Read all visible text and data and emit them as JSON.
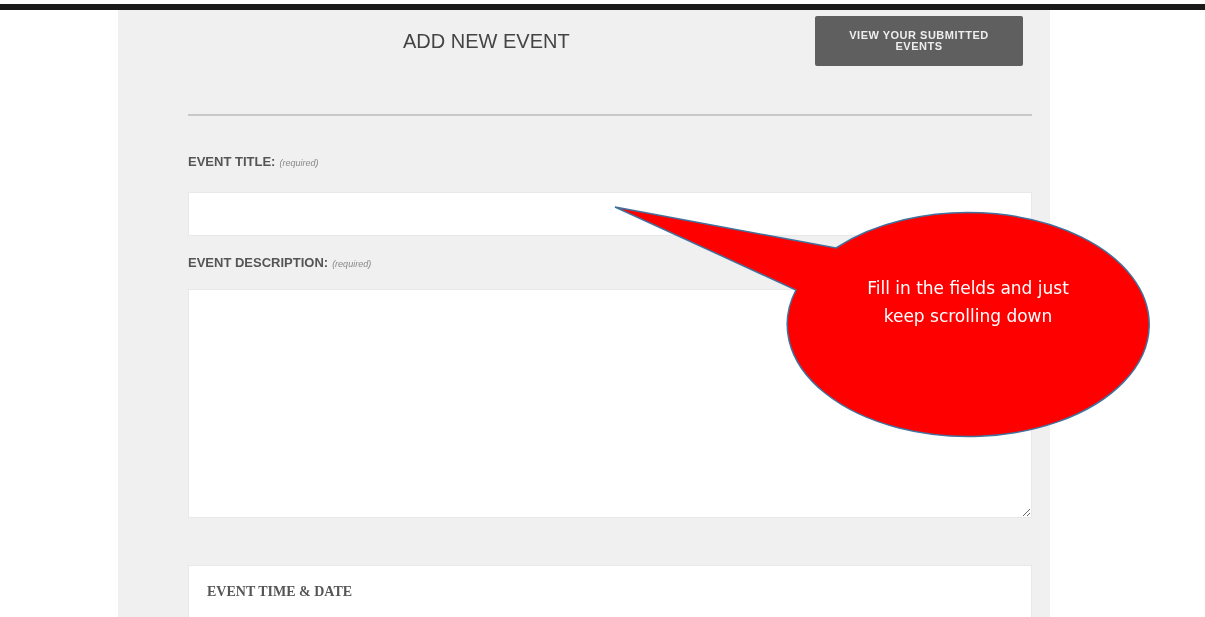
{
  "header": {
    "title": "ADD NEW EVENT",
    "button": "VIEW YOUR SUBMITTED EVENTS"
  },
  "fields": [
    {
      "kind": "input",
      "label": "EVENT TITLE:",
      "note": "(required)"
    },
    {
      "kind": "textarea",
      "label": "EVENT DESCRIPTION:",
      "note": "(required)"
    }
  ],
  "section": {
    "heading": "EVENT TIME & DATE"
  },
  "callout": {
    "text": "Fill in the fields and just keep scrolling down"
  }
}
